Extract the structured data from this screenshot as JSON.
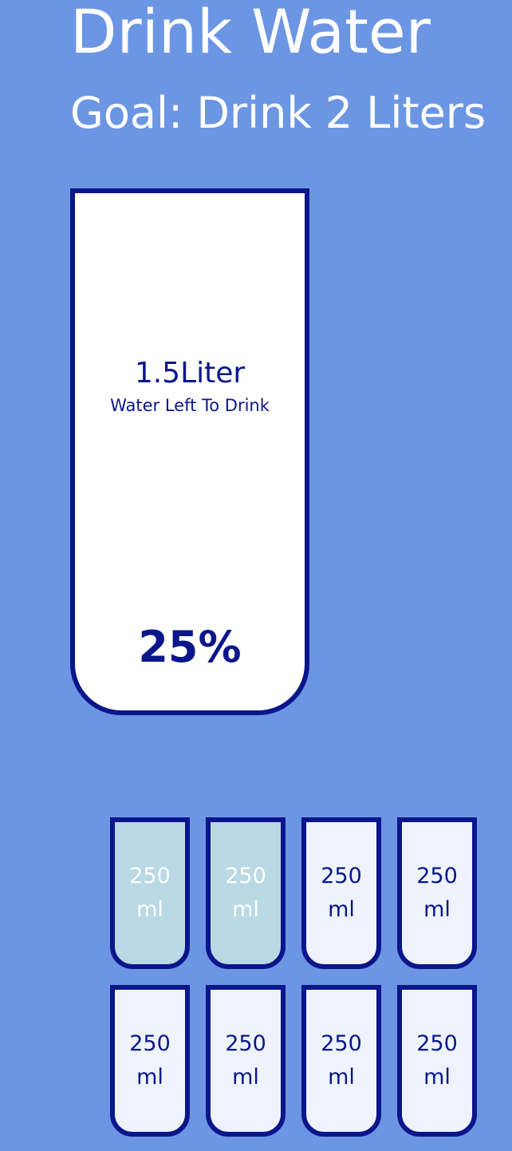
{
  "header": {
    "title": "Drink Water",
    "goal": "Goal: Drink 2 Liters"
  },
  "big_cup": {
    "remained_value": "1.5Liter",
    "remained_label": "Water Left To Drink",
    "percentage": "25%",
    "progress_fraction": 0.25
  },
  "small_cups": [
    {
      "amount": "250",
      "unit": "ml",
      "full": true
    },
    {
      "amount": "250",
      "unit": "ml",
      "full": true
    },
    {
      "amount": "250",
      "unit": "ml",
      "full": false
    },
    {
      "amount": "250",
      "unit": "ml",
      "full": false
    },
    {
      "amount": "250",
      "unit": "ml",
      "full": false
    },
    {
      "amount": "250",
      "unit": "ml",
      "full": false
    },
    {
      "amount": "250",
      "unit": "ml",
      "full": false
    },
    {
      "amount": "250",
      "unit": "ml",
      "full": false
    }
  ],
  "colors": {
    "background": "#6c96e4",
    "cup_border": "#0b168b",
    "cup_full": "#b9d9e5",
    "cup_empty": "#eef3fd",
    "text_light": "#ffffff"
  }
}
